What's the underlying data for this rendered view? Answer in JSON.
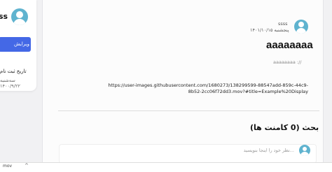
{
  "profile": {
    "name": "ss",
    "edit_button": "ویرایش",
    "join_label": "تاریخ ثبت نام",
    "join_date": "سه‌شنبه ۱۴۰۰/۹/۲۲"
  },
  "post": {
    "author": "ssss",
    "date": "پنجشنبه ۱۴۰۱/۱۰/۱۵",
    "title": "aaaaaaaa",
    "body": "aaaaaaaa ://",
    "link": "https://user-images.githubusercontent.com/1680273/138299599-88547add-859c-44c9-8b52-2cc06f72dd3.mov?#title=Example%20Display"
  },
  "discussion": {
    "title": "بحث (0 کامنت ها)",
    "comment_placeholder": "نظر خود را اینجا بنویسید..."
  },
  "bottom_bar": {
    "file_label": "mov"
  },
  "colors": {
    "accent": "#4468e6",
    "avatar": "#5fb3cf"
  },
  "icons": [
    "user-avatar-icon",
    "chevron-up-icon"
  ]
}
